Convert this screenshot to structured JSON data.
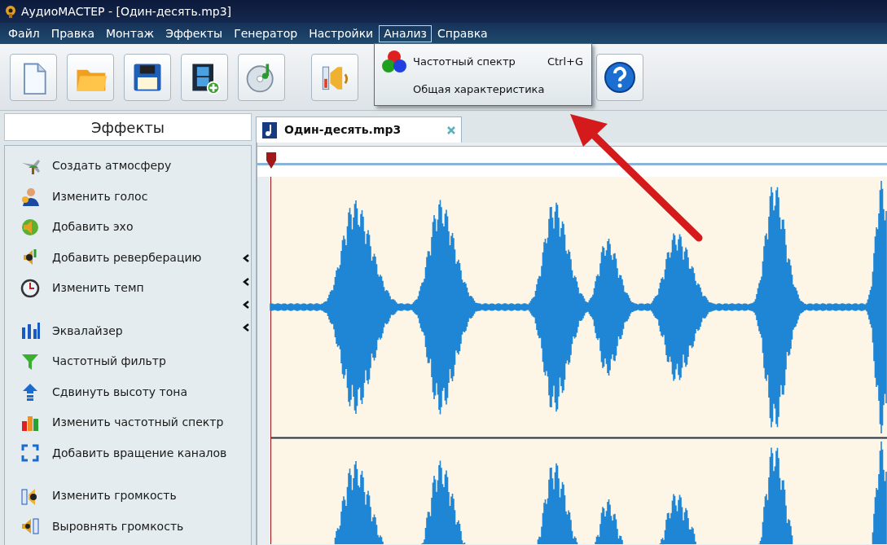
{
  "window": {
    "title": "АудиоМАСТЕР - [Один-десять.mp3]"
  },
  "menu": [
    {
      "label": "Файл",
      "selected": false
    },
    {
      "label": "Правка",
      "selected": false
    },
    {
      "label": "Монтаж",
      "selected": false
    },
    {
      "label": "Эффекты",
      "selected": false
    },
    {
      "label": "Генератор",
      "selected": false
    },
    {
      "label": "Настройки",
      "selected": false
    },
    {
      "label": "Анализ",
      "selected": true
    },
    {
      "label": "Справка",
      "selected": false
    }
  ],
  "dropdown": [
    {
      "label": "Частотный спектр",
      "shortcut": "Ctrl+G"
    },
    {
      "label": "Общая характеристика"
    }
  ],
  "effects_panel": {
    "title": "Эффекты",
    "groups": [
      [
        "Создать атмосферу",
        "Изменить голос",
        "Добавить эхо",
        "Добавить реверберацию",
        "Изменить темп"
      ],
      [
        "Эквалайзер",
        "Частотный фильтр",
        "Сдвинуть высоту тона",
        "Изменить частотный спектр",
        "Добавить вращение каналов"
      ],
      [
        "Изменить громкость",
        "Выровнять громкость"
      ]
    ]
  },
  "file_tab": {
    "label": "Один-десять.mp3",
    "selected": true
  }
}
